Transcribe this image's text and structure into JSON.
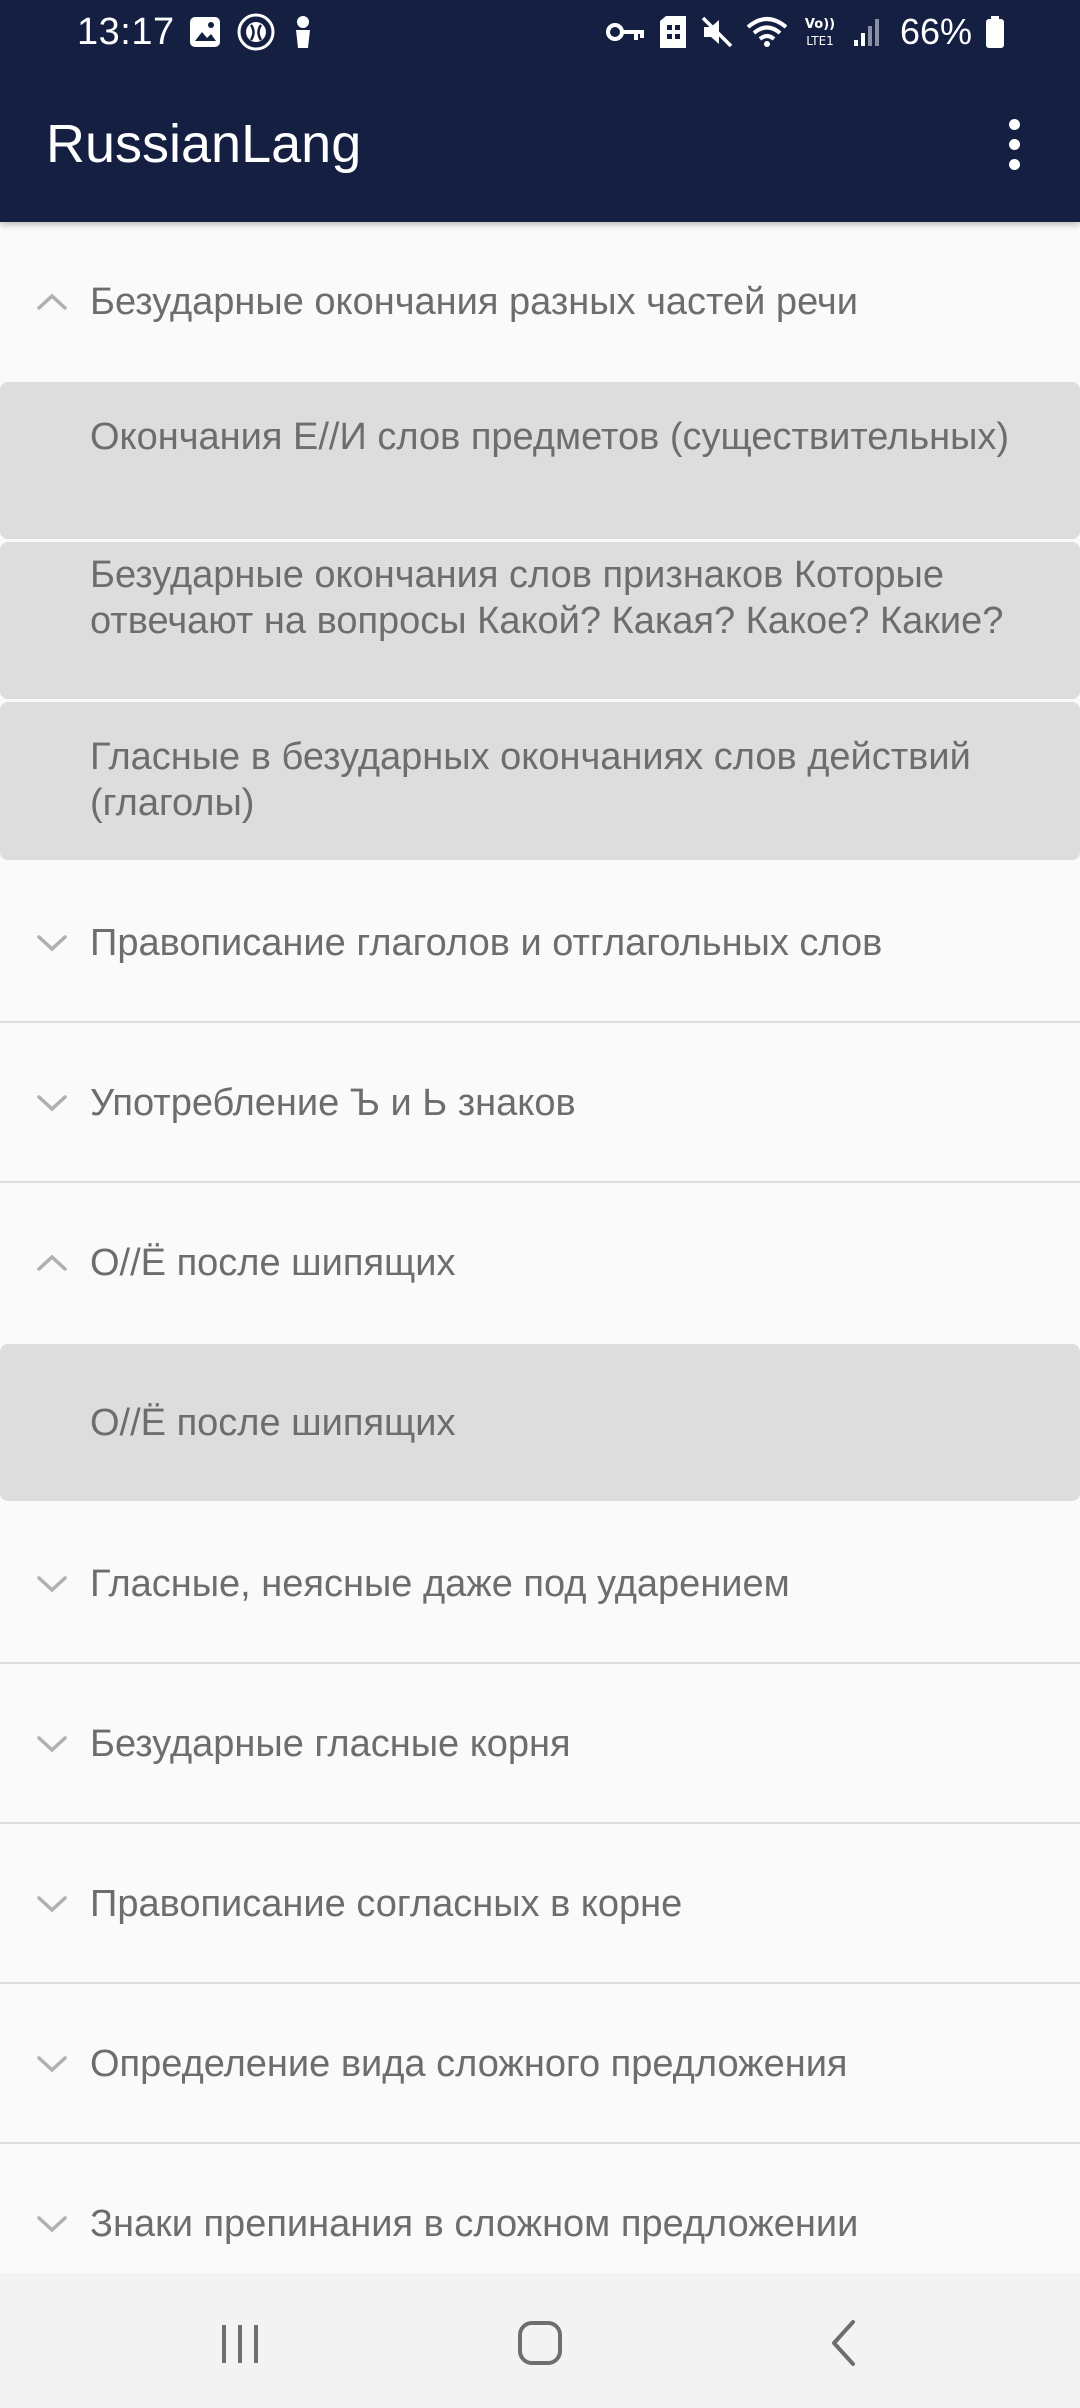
{
  "status_bar": {
    "time": "13:17",
    "battery": "66%",
    "left_icons": [
      "image-icon",
      "browser-icon",
      "person-icon"
    ],
    "right_icons": [
      "vpn-key-icon",
      "sim-icon",
      "mute-icon",
      "wifi-icon",
      "volte-icon",
      "signal-icon",
      "battery-icon"
    ]
  },
  "app_bar": {
    "title": "RussianLang",
    "menu_icon": "more-vert-icon"
  },
  "list": {
    "groups": [
      {
        "label": "Безударные окончания разных частей речи",
        "expanded": true,
        "children": [
          "Окончания Е//И слов предметов (существительных)",
          "Безударные окончания слов признаков Которые отвечают на вопросы Какой? Какая? Какое? Какие?",
          "Гласные в безударных окончаниях слов действий (глаголы)"
        ]
      },
      {
        "label": "Правописание глаголов и отглагольных слов",
        "expanded": false
      },
      {
        "label": "Употребление Ъ и Ь знаков",
        "expanded": false
      },
      {
        "label": "О//Ё после шипящих",
        "expanded": true,
        "children": [
          "О//Ё после шипящих"
        ]
      },
      {
        "label": "Гласные, неясные даже под ударением",
        "expanded": false
      },
      {
        "label": "Безударные гласные корня",
        "expanded": false
      },
      {
        "label": "Правописание согласных в корне",
        "expanded": false
      },
      {
        "label": "Определение вида сложного предложения",
        "expanded": false
      },
      {
        "label": "Знаки препинания в сложном предложении",
        "expanded": false
      }
    ]
  },
  "nav_bar": {
    "buttons": [
      "recents-icon",
      "home-icon",
      "back-icon"
    ]
  },
  "colors": {
    "app_bar": "#141f42",
    "background": "#fafafa",
    "child_background": "#dddddd",
    "text": "#6d6d6d"
  }
}
